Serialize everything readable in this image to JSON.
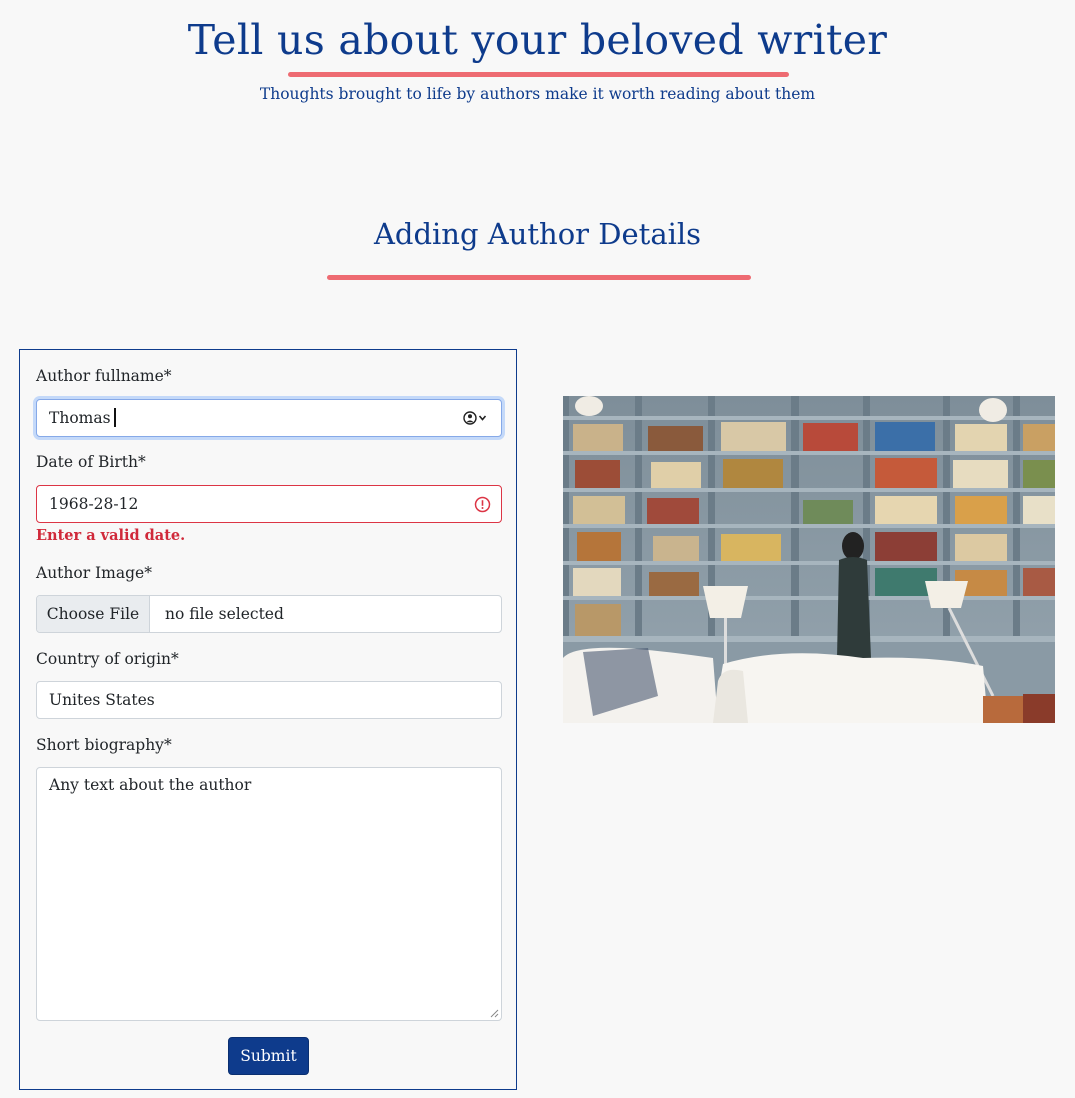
{
  "header": {
    "title": "Tell us about your beloved writer",
    "subtitle": "Thoughts brought to life by authors make it worth reading about them"
  },
  "section": {
    "title": "Adding Author Details"
  },
  "form": {
    "fullname_label": "Author fullname*",
    "fullname_value": "Thomas",
    "dob_label": "Date of Birth*",
    "dob_value": "1968-28-12",
    "dob_error": "Enter a valid date.",
    "image_label": "Author Image*",
    "file_button": "Choose File",
    "file_status": "no file selected",
    "country_label": "Country of origin*",
    "country_value": "Unites States",
    "bio_label": "Short biography*",
    "bio_value": "Any text about the author",
    "submit_label": "Submit"
  },
  "icons": {
    "autofill": "user-circle-chevron-icon",
    "error": "exclamation-circle-icon"
  },
  "colors": {
    "accent": "#0e3b8c",
    "underline": "#ee6b72",
    "error": "#dc3545"
  }
}
